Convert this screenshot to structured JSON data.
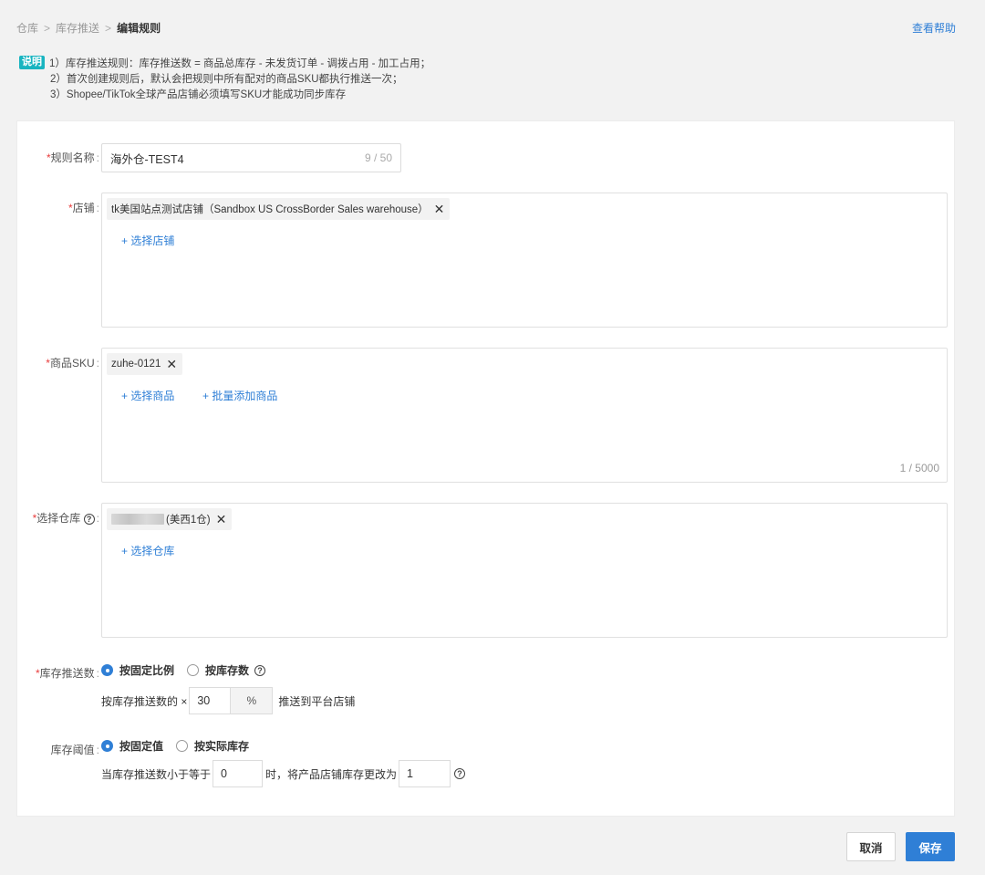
{
  "breadcrumb": {
    "items": [
      "仓库",
      "库存推送"
    ],
    "separator": ">",
    "current": "编辑规则"
  },
  "help_link": "查看帮助",
  "notes": {
    "badge": "说明",
    "lines": [
      "1）库存推送规则：库存推送数 = 商品总库存 - 未发货订单 - 调拨占用 - 加工占用；",
      "2）首次创建规则后，默认会把规则中所有配对的商品SKU都执行推送一次；",
      "3）Shopee/TikTok全球产品店铺必须填写SKU才能成功同步库存"
    ]
  },
  "form": {
    "rule_name": {
      "label": "规则名称",
      "value": "海外仓-TEST4",
      "count": "9 / 50"
    },
    "store": {
      "label": "店铺",
      "tags": [
        "tk美国站点测试店铺（Sandbox US CrossBorder Sales warehouse）"
      ],
      "add_label": "+ 选择店铺"
    },
    "sku": {
      "label": "商品SKU",
      "tags": [
        "zuhe-0121"
      ],
      "add_label": "+ 选择商品",
      "batch_label": "+ 批量添加商品",
      "count": "1 / 5000"
    },
    "warehouse": {
      "label": "选择仓库",
      "help_icon": "?",
      "tag_suffix": "(美西1仓)",
      "add_label": "+ 选择仓库"
    },
    "push_count": {
      "label": "库存推送数",
      "options": [
        "按固定比例",
        "按库存数"
      ],
      "selected": "按固定比例",
      "prefix": "按库存推送数的 ×",
      "value": "30",
      "unit": "%",
      "suffix": "推送到平台店铺"
    },
    "threshold": {
      "label": "库存阈值",
      "options": [
        "按固定值",
        "按实际库存"
      ],
      "selected": "按固定值",
      "prefix": "当库存推送数小于等于",
      "value1": "0",
      "middle": "时，将产品店铺库存更改为",
      "value2": "1"
    }
  },
  "buttons": {
    "cancel": "取消",
    "save": "保存"
  },
  "colors": {
    "primary": "#2f7fd6",
    "required": "#e83c3c",
    "badge": "#18b4c0"
  },
  "icons": {
    "remove": "close-icon",
    "help": "question-circle-icon"
  }
}
